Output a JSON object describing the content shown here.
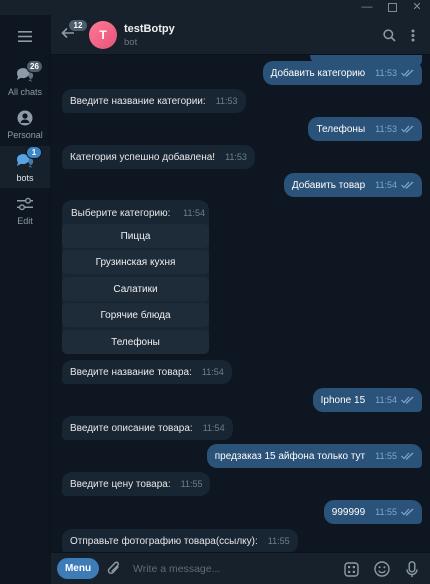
{
  "sidebar": {
    "items": [
      {
        "label": "All chats",
        "badge": "26",
        "icon": "chat-bubbles-icon"
      },
      {
        "label": "Personal",
        "badge": "",
        "icon": "person-icon"
      },
      {
        "label": "bots",
        "badge": "1",
        "icon": "chat-bubbles-icon"
      },
      {
        "label": "Edit",
        "badge": "",
        "icon": "sliders-icon"
      }
    ]
  },
  "header": {
    "back_badge": "12",
    "avatar_letter": "T",
    "title": "testBotpy",
    "subtitle": "bot"
  },
  "messages": [
    {
      "dir": "out",
      "text": "Добавить категорию",
      "time": "11:53"
    },
    {
      "dir": "in",
      "text": "Введите название категории:",
      "time": "11:53"
    },
    {
      "dir": "out",
      "text": "Телефоны",
      "time": "11:53"
    },
    {
      "dir": "in",
      "text": "Категория успешно добавлена!",
      "time": "11:53"
    },
    {
      "dir": "out",
      "text": "Добавить товар",
      "time": "11:54"
    },
    {
      "dir": "in",
      "text": "Введите название товара:",
      "time": "11:54"
    },
    {
      "dir": "out",
      "text": "Iphone 15",
      "time": "11:54"
    },
    {
      "dir": "in",
      "text": "Введите описание товара:",
      "time": "11:54"
    },
    {
      "dir": "out",
      "text": "предзаказ 15 айфона только тут",
      "time": "11:55"
    },
    {
      "dir": "in",
      "text": "Введите цену товара:",
      "time": "11:55"
    },
    {
      "dir": "out",
      "text": "999999",
      "time": "11:55"
    },
    {
      "dir": "in",
      "text": "Отправьте фотографию товара(ссылку):",
      "time": "11:55"
    }
  ],
  "keyboard_message": {
    "text": "Выберите категорию:",
    "time": "11:54",
    "buttons": [
      "Пицца",
      "Грузинская кухня",
      "Салатики",
      "Горячие блюда",
      "Телефоны"
    ]
  },
  "composer": {
    "menu_label": "Menu",
    "placeholder": "Write a message..."
  },
  "colors": {
    "background": "#0e1621",
    "panel": "#17212b",
    "incoming_bubble": "#182533",
    "outgoing_bubble": "#2b5278",
    "accent": "#3e7cb8",
    "avatar": "#e5537a"
  }
}
